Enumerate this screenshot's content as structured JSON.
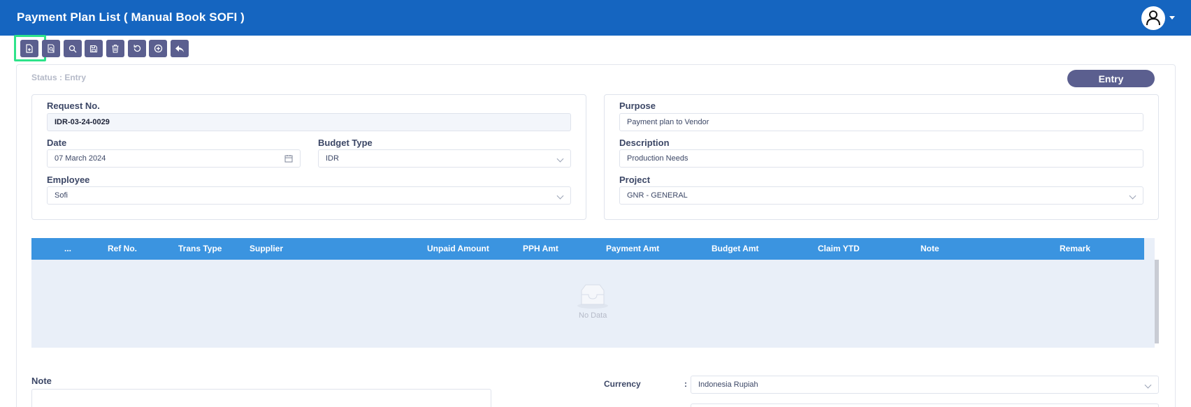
{
  "header": {
    "title": "Payment Plan List ( Manual Book SOFI )"
  },
  "toolbar": {
    "buttons": [
      {
        "name": "new-document-button",
        "icon": "file-plus-icon"
      },
      {
        "name": "preview-button",
        "icon": "file-search-icon"
      },
      {
        "name": "search-button",
        "icon": "search-icon"
      },
      {
        "name": "save-button",
        "icon": "save-icon"
      },
      {
        "name": "delete-button",
        "icon": "trash-icon"
      },
      {
        "name": "refresh-button",
        "icon": "refresh-icon"
      },
      {
        "name": "add-button",
        "icon": "plus-circle-icon"
      },
      {
        "name": "back-button",
        "icon": "reply-icon"
      }
    ]
  },
  "status": {
    "text": "Status : Entry",
    "pill": "Entry"
  },
  "form": {
    "request_no_label": "Request No.",
    "request_no_value": "IDR-03-24-0029",
    "date_label": "Date",
    "date_value": "07 March 2024",
    "budget_type_label": "Budget Type",
    "budget_type_value": "IDR",
    "employee_label": "Employee",
    "employee_value": "Sofi",
    "purpose_label": "Purpose",
    "purpose_value": "Payment plan to Vendor",
    "description_label": "Description",
    "description_value": "Production Needs",
    "project_label": "Project",
    "project_value": "GNR - GENERAL"
  },
  "table": {
    "columns": [
      "...",
      "Ref No.",
      "Trans Type",
      "Supplier",
      "Unpaid Amount",
      "PPH Amt",
      "Payment Amt",
      "Budget Amt",
      "Claim YTD",
      "Note",
      "Remark"
    ],
    "empty_text": "No Data"
  },
  "footer": {
    "note_label": "Note",
    "currency_label": "Currency",
    "currency_colon": ":",
    "currency_value": "Indonesia Rupiah"
  },
  "colors": {
    "header": "#1565c0",
    "toolbar_button": "#5b5f8f",
    "table_header": "#3b94e0",
    "highlight": "#2ee38a"
  }
}
